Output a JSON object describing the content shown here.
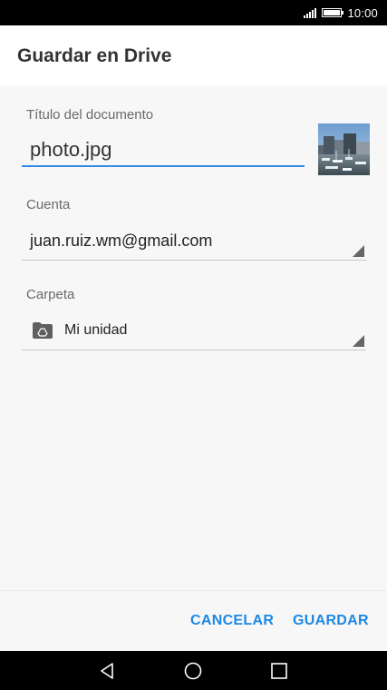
{
  "status_bar": {
    "time": "10:00",
    "icons": [
      "signal-icon",
      "battery-icon"
    ]
  },
  "dialog": {
    "title": "Guardar en Drive"
  },
  "document_title": {
    "label": "Título del documento",
    "value": "photo.jpg"
  },
  "account": {
    "label": "Cuenta",
    "value": "juan.ruiz.wm@gmail.com"
  },
  "folder": {
    "label": "Carpeta",
    "value": "Mi unidad",
    "icon": "drive-folder-icon"
  },
  "buttons": {
    "cancel": "CANCELAR",
    "save": "GUARDAR"
  },
  "navigation": {
    "icons": [
      "back-icon",
      "home-icon",
      "recents-icon"
    ]
  },
  "colors": {
    "accent": "#1e88e5",
    "underline_active": "#2f8be6",
    "background": "#f7f7f7"
  }
}
